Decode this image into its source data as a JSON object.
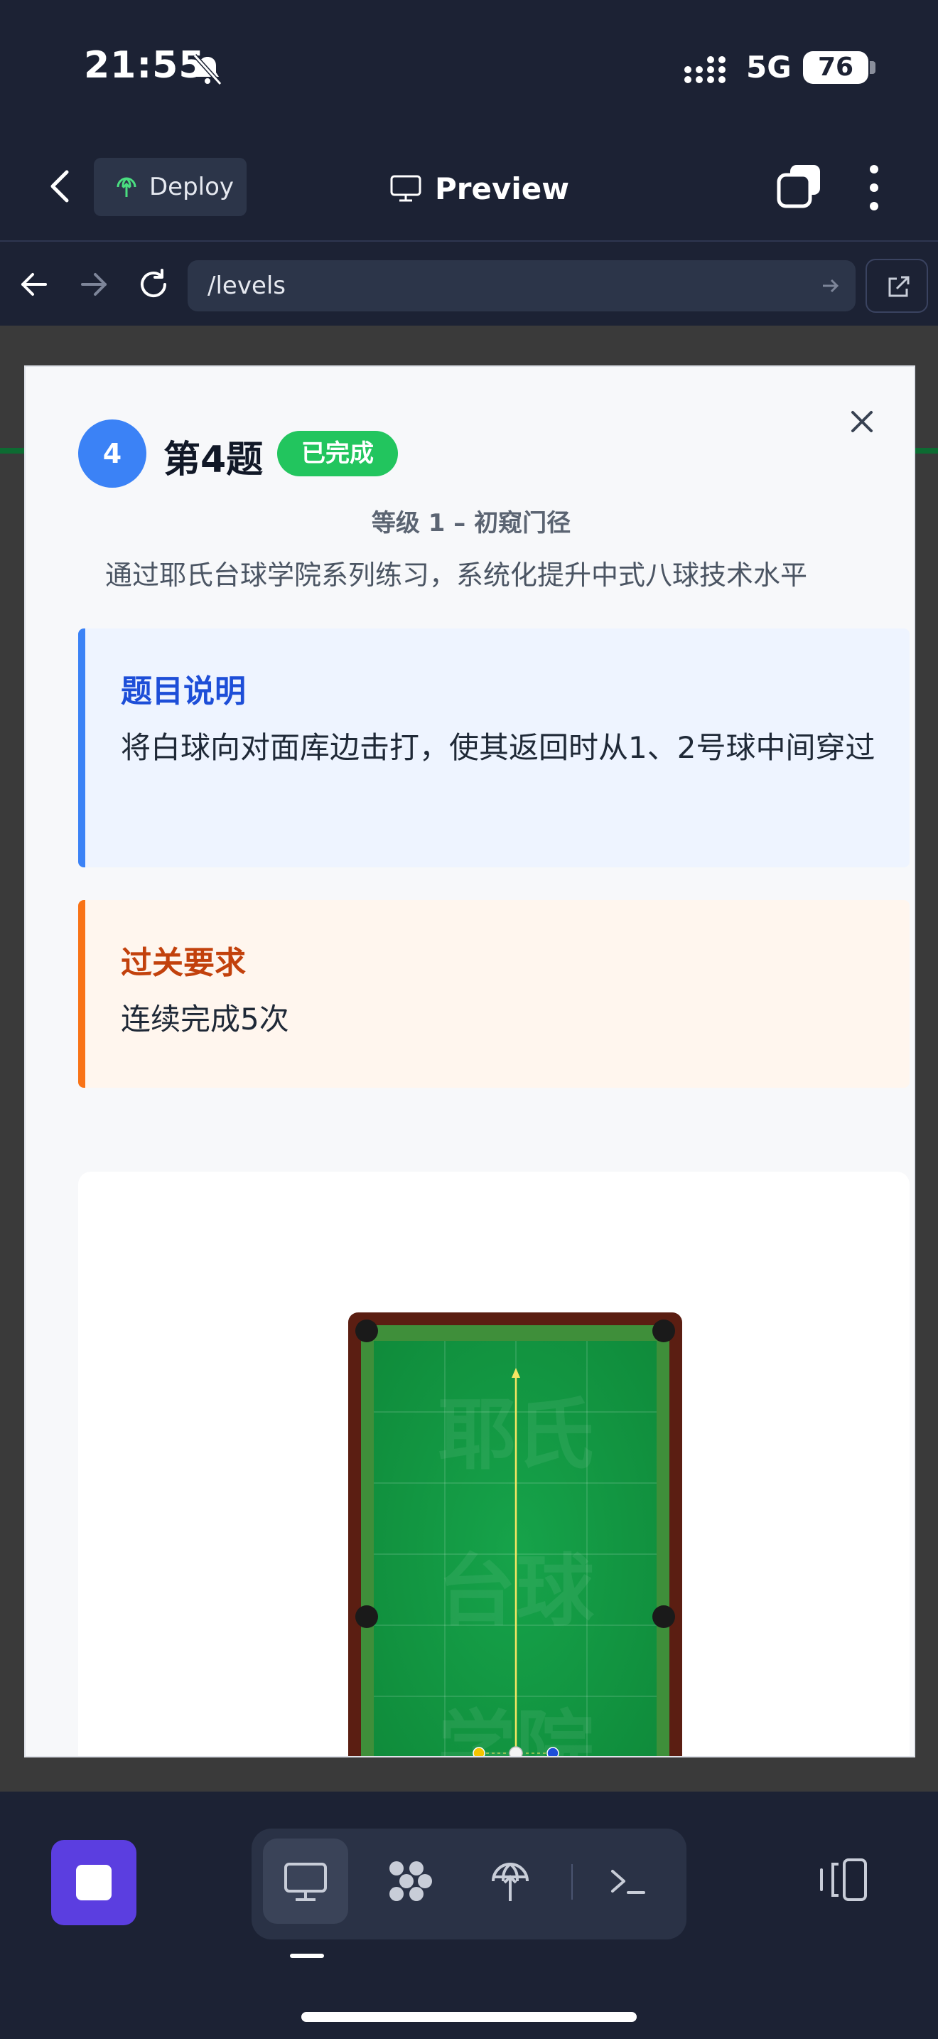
{
  "status_bar": {
    "time": "21:55",
    "network": "5G",
    "battery": "76"
  },
  "top_bar": {
    "deploy_label": "Deploy",
    "preview_label": "Preview"
  },
  "browser": {
    "url": "/levels"
  },
  "modal": {
    "level_number": "4",
    "title": "第4题",
    "status": "已完成",
    "level_name": "等级 1 – 初窥门径",
    "level_description": "通过耶氏台球学院系列练习，系统化提升中式八球技术水平",
    "description_card": {
      "title": "题目说明",
      "body": "将白球向对面库边击打，使其返回时从1、2号球中间穿过"
    },
    "requirement_card": {
      "title": "过关要求",
      "body": "连续完成5次"
    },
    "table": {
      "watermark_lines": [
        "耶氏",
        "台球",
        "学院"
      ],
      "colors": {
        "felt": "#13a34a",
        "rail": "#5b1e12",
        "cushion": "#3f8f3a",
        "aim_line": "#f5e663"
      }
    }
  },
  "colors": {
    "accent": "#3b82f6",
    "success": "#22c55e",
    "warning": "#f97316",
    "stop": "#5b3ee0"
  }
}
